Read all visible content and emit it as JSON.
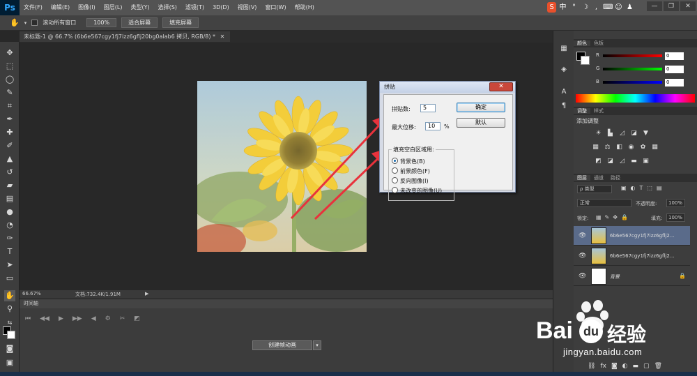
{
  "app": {
    "logo": "Ps"
  },
  "menu": [
    "文件(F)",
    "编辑(E)",
    "图像(I)",
    "图层(L)",
    "类型(Y)",
    "选择(S)",
    "滤镜(T)",
    "3D(D)",
    "视图(V)",
    "窗口(W)",
    "帮助(H)"
  ],
  "options": {
    "scroll_all": "滚动所有窗口",
    "zoom100": "100%",
    "fit_screen": "适合屏幕",
    "fill_screen": "填充屏幕"
  },
  "document": {
    "tab_title": "未标题-1 @ 66.7% (6b6e567cgy1fj7izz6gflj20bg0alab6 拷贝, RGB/8) *",
    "zoom": "66.67%",
    "doc_info": "文档:732.4K/1.91M"
  },
  "timeline": {
    "title": "时间轴",
    "create_button": "创建帧动画"
  },
  "color_panel": {
    "tabs": [
      "颜色",
      "色板"
    ],
    "channels": [
      {
        "label": "R",
        "value": "0"
      },
      {
        "label": "G",
        "value": "0"
      },
      {
        "label": "B",
        "value": "0"
      }
    ]
  },
  "adjust_panel": {
    "tabs": [
      "调整",
      "样式"
    ],
    "title": "添加调整"
  },
  "layers_panel": {
    "tabs": [
      "图层",
      "通道",
      "路径"
    ],
    "filter_kind": "ρ 类型",
    "blend_mode": "正常",
    "opacity_label": "不透明度:",
    "opacity_value": "100%",
    "lock_label": "锁定:",
    "fill_label": "填充:",
    "fill_value": "100%",
    "layers": [
      {
        "name": "6b6e567cgy1fj7izz6gflj2...",
        "selected": true
      },
      {
        "name": "6b6e567cgy1fj7izz6gflj2...",
        "selected": false
      },
      {
        "name": "背景",
        "selected": false
      }
    ],
    "footer_icons": [
      "link-icon",
      "fx-icon",
      "mask-icon",
      "adjust-icon",
      "folder-icon",
      "new-layer-icon",
      "trash-icon"
    ]
  },
  "dialog": {
    "title": "拼贴",
    "tiles_label": "拼贴数:",
    "tiles_value": "5",
    "offset_label": "最大位移:",
    "offset_value": "10",
    "offset_unit": "%",
    "fill_group": "填充空白区域用:",
    "options": [
      {
        "label": "背景色(B)",
        "checked": true
      },
      {
        "label": "前景颜色(F)",
        "checked": false
      },
      {
        "label": "反向图像(I)",
        "checked": false
      },
      {
        "label": "未改变的图像(U)",
        "checked": false
      }
    ],
    "ok": "确定",
    "reset": "默认"
  },
  "watermark": {
    "brand": "Bai",
    "brand_cn": "经验",
    "url": "jingyan.baidu.com"
  },
  "colors": {
    "accent": "#31a8ff",
    "arrow": "#e8323c",
    "panel": "#3d3d3d"
  }
}
